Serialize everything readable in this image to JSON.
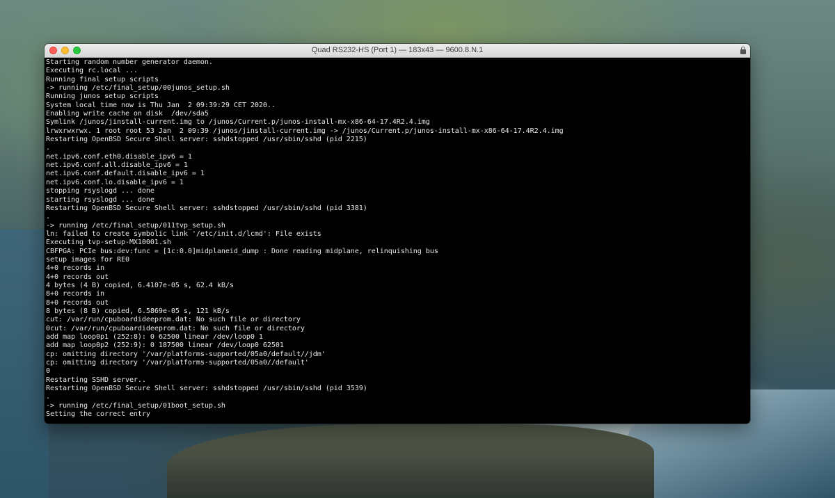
{
  "window": {
    "title": "Quad RS232-HS (Port 1) — 183x43 — 9600.8.N.1",
    "controls": {
      "close": "close-button",
      "minimize": "minimize-button",
      "zoom": "zoom-button"
    },
    "lock_icon": "lock-icon"
  },
  "terminal": {
    "lines": [
      "Starting random number generator daemon.",
      "Executing rc.local ...",
      "Running final setup scripts",
      "-> running /etc/final_setup/00junos_setup.sh",
      "Running junos setup scripts",
      "System local time now is Thu Jan  2 09:39:29 CET 2020..",
      "Enabling write cache on disk  /dev/sda5",
      "Symlink /junos/jinstall-current.img to /junos/Current.p/junos-install-mx-x86-64-17.4R2.4.img",
      "lrwxrwxrwx. 1 root root 53 Jan  2 09:39 /junos/jinstall-current.img -> /junos/Current.p/junos-install-mx-x86-64-17.4R2.4.img",
      "Restarting OpenBSD Secure Shell server: sshdstopped /usr/sbin/sshd (pid 2215)",
      ".",
      "net.ipv6.conf.eth0.disable_ipv6 = 1",
      "net.ipv6.conf.all.disable_ipv6 = 1",
      "net.ipv6.conf.default.disable_ipv6 = 1",
      "net.ipv6.conf.lo.disable_ipv6 = 1",
      "stopping rsyslogd ... done",
      "starting rsyslogd ... done",
      "Restarting OpenBSD Secure Shell server: sshdstopped /usr/sbin/sshd (pid 3381)",
      ".",
      "-> running /etc/final_setup/011tvp_setup.sh",
      "ln: failed to create symbolic link '/etc/init.d/lcmd': File exists",
      "Executing tvp-setup-MX10001.sh",
      "CBFPGA: PCIe bus:dev:func = [1c:0.0]midplaneid_dump : Done reading midplane, relinquishing bus",
      "setup images for RE0",
      "4+0 records in",
      "4+0 records out",
      "4 bytes (4 B) copied, 6.4107e-05 s, 62.4 kB/s",
      "8+0 records in",
      "8+0 records out",
      "8 bytes (8 B) copied, 6.5869e-05 s, 121 kB/s",
      "cut: /var/run/cpuboardideeprom.dat: No such file or directory",
      "0cut: /var/run/cpuboardideeprom.dat: No such file or directory",
      "add map loop0p1 (252:8): 0 62500 linear /dev/loop0 1",
      "add map loop0p2 (252:9): 0 187500 linear /dev/loop0 62501",
      "cp: omitting directory '/var/platforms-supported/05a0/default//jdm'",
      "cp: omitting directory '/var/platforms-supported/05a0//default'",
      "0",
      "Restarting SSHD server..",
      "Restarting OpenBSD Secure Shell server: sshdstopped /usr/sbin/sshd (pid 3539)",
      ".",
      "-> running /etc/final_setup/01boot_setup.sh",
      "Setting the correct entry"
    ]
  }
}
